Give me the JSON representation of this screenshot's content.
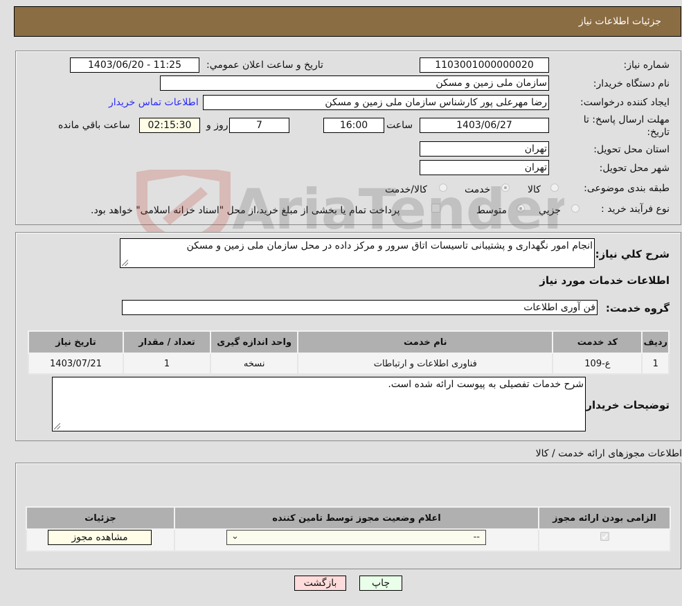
{
  "header": {
    "title": "جزئیات اطلاعات نیاز"
  },
  "details": {
    "need_number_label": "شماره نیاز:",
    "need_number": "1103001000000020",
    "announce_label": "تاریخ و ساعت اعلان عمومي:",
    "announce_value": "1403/06/20 - 11:25",
    "buyer_org_label": "نام دستگاه خریدار:",
    "buyer_org": "سازمان ملی زمین و مسکن",
    "requester_label": "ایجاد کننده درخواست:",
    "requester": "رضا مهرعلی پور کارشناس سازمان ملی زمین و مسکن",
    "buyer_contact_link": "اطلاعات تماس خریدار",
    "deadline_label": "مهلت ارسال پاسخ: تا تاریخ:",
    "deadline_date": "1403/06/27",
    "time_label": "ساعت",
    "deadline_time": "16:00",
    "days_value": "7",
    "days_label": "روز و",
    "remaining_time": "02:15:30",
    "remaining_label": "ساعت باقي مانده",
    "province_label": "استان محل تحویل:",
    "province": "تهران",
    "city_label": "شهر محل تحویل:",
    "city": "تهران",
    "category_label": "طبقه بندی موضوعی:",
    "category_options": [
      {
        "label": "کالا",
        "selected": false
      },
      {
        "label": "خدمت",
        "selected": true
      },
      {
        "label": "کالا/خدمت",
        "selected": false
      }
    ],
    "process_label": "نوع فرآیند خرید :",
    "process_options": [
      {
        "label": "جزيي",
        "selected": false
      },
      {
        "label": "متوسط",
        "selected": true
      }
    ],
    "treasury_note": "پرداخت تمام یا بخشی از مبلغ خرید،از محل \"اسناد خزانه اسلامی\" خواهد بود.",
    "treasury_checked": false
  },
  "description": {
    "general_label": "شرح کلي نیاز:",
    "general_value": "انجام امور نگهداری و پشتیبانی تاسیسات اتاق سرور و مرکز داده در محل سازمان ملی زمین و مسکن",
    "services_heading": "اطلاعات خدمات مورد نیاز",
    "service_group_label": "گروه خدمت:",
    "service_group": "فن آوری اطلاعات"
  },
  "services_table": {
    "columns": [
      "ردیف",
      "کد خدمت",
      "نام خدمت",
      "واحد اندازه گیری",
      "تعداد / مقدار",
      "تاریخ نیاز"
    ],
    "rows": [
      [
        "1",
        "ع-109",
        "فناوری اطلاعات و ارتباطات",
        "نسخه",
        "1",
        "1403/07/21"
      ]
    ]
  },
  "buyer_notes": {
    "label": "توضیحات خریدار:",
    "value": "شرح خدمات تفصیلی به پیوست ارائه شده است."
  },
  "permits": {
    "heading": "اطلاعات مجوزهای ارائه خدمت / کالا",
    "columns": [
      "الزامی بودن ارائه مجوز",
      "اعلام وضعیت مجوز توسط تامین کننده",
      "جزئیات"
    ],
    "row": {
      "required_checked": true,
      "status_value": "--",
      "details_button": "مشاهده مجوز"
    }
  },
  "buttons": {
    "print": "چاپ",
    "back": "بازگشت"
  },
  "watermark": {
    "text": "AriaTender.neT"
  }
}
